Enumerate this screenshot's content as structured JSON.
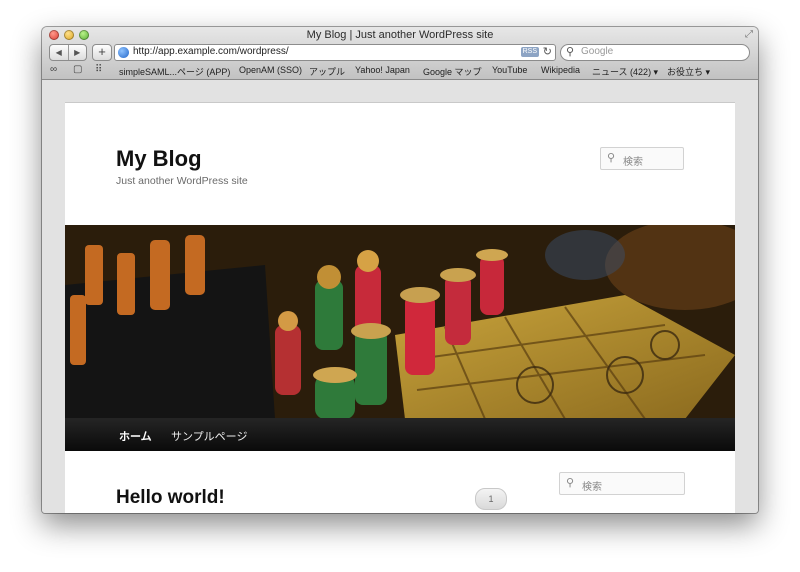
{
  "window": {
    "title": "My Blog | Just another WordPress site"
  },
  "toolbar": {
    "back_label": "◀",
    "forward_label": "▶",
    "add_label": "+",
    "url": "http://app.example.com/wordpress/",
    "rss_label": "RSS",
    "reload_label": "↻",
    "search_placeholder": "Google"
  },
  "bookmarks": {
    "items": [
      "simpleSAML...ページ (APP)",
      "OpenAM (SSO)",
      "アップル",
      "Yahoo! Japan",
      "Google マップ",
      "YouTube",
      "Wikipedia",
      "ニュース (422) ▾",
      "お役立ち ▾"
    ]
  },
  "site": {
    "title": "My Blog",
    "description": "Just another WordPress site",
    "search_placeholder": "検索"
  },
  "nav": {
    "items": [
      "ホーム",
      "サンプルページ"
    ]
  },
  "sidebar": {
    "search_placeholder": "検索"
  },
  "post": {
    "title": "Hello world!",
    "comment_count": "1"
  },
  "header_image": {
    "subject": "chess-board-photo"
  }
}
